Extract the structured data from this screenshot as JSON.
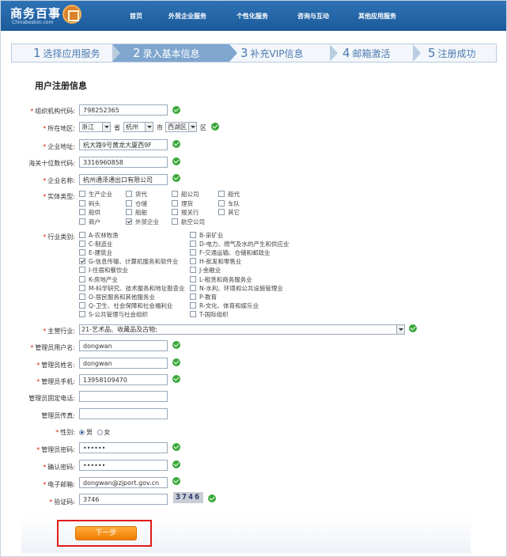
{
  "header": {
    "logo_text": "商务百事",
    "logo_sub": "Chinabeston.com",
    "nav": [
      "首页",
      "外贸企业服务",
      "个性化服务",
      "咨询与互动",
      "其他应用服务"
    ]
  },
  "steps": [
    {
      "num": "1",
      "label": "选择应用服务"
    },
    {
      "num": "2",
      "label": "录入基本信息"
    },
    {
      "num": "3",
      "label": "补充VIP信息"
    },
    {
      "num": "4",
      "label": "邮箱激活"
    },
    {
      "num": "5",
      "label": "注册成功"
    }
  ],
  "form": {
    "section_title": "用户注册信息",
    "org_code": {
      "label": "组织机构代码:",
      "value": "798252365"
    },
    "region": {
      "label": "所在地区:",
      "province": "浙江",
      "province_unit": "省",
      "city": "杭州",
      "city_unit": "市",
      "district": "西湖区",
      "district_unit": "区"
    },
    "address": {
      "label": "企业地址:",
      "value": "杭大路9号黄龙大厦西9F"
    },
    "customs_code": {
      "label": "海关十位数代码:",
      "value": "3316960858"
    },
    "company_name": {
      "label": "企业名称:",
      "value": "杭州通泽通出口有限公司"
    },
    "entity_type": {
      "label": "实体类型:",
      "options": [
        {
          "label": "生产企业",
          "checked": false
        },
        {
          "label": "货代",
          "checked": false
        },
        {
          "label": "船公司",
          "checked": false
        },
        {
          "label": "船代",
          "checked": false
        },
        {
          "label": "码头",
          "checked": false
        },
        {
          "label": "仓储",
          "checked": false
        },
        {
          "label": "理货",
          "checked": false
        },
        {
          "label": "车队",
          "checked": false
        },
        {
          "label": "船供",
          "checked": false
        },
        {
          "label": "船舶",
          "checked": false
        },
        {
          "label": "报关行",
          "checked": false
        },
        {
          "label": "其它",
          "checked": false
        },
        {
          "label": "商户",
          "checked": false
        },
        {
          "label": "外贸企业",
          "checked": true
        },
        {
          "label": "航空公司",
          "checked": false
        }
      ]
    },
    "industry": {
      "label": "行业类别:",
      "left": [
        {
          "label": "A-农林牧渔",
          "checked": false
        },
        {
          "label": "C-制造业",
          "checked": false
        },
        {
          "label": "E-建筑业",
          "checked": false
        },
        {
          "label": "G-信息传输、计算机服务和软件业",
          "checked": true
        },
        {
          "label": "I-住宿和餐饮业",
          "checked": false
        },
        {
          "label": "K-房地产业",
          "checked": false
        },
        {
          "label": "M-科学研究、技术服务和地址勘查业",
          "checked": false
        },
        {
          "label": "O-居民服务和其他服务业",
          "checked": false
        },
        {
          "label": "Q-卫生、社会保障和社会福利业",
          "checked": false
        },
        {
          "label": "S-公共管理与社会组织",
          "checked": false
        }
      ],
      "right": [
        {
          "label": "B-采矿业",
          "checked": false
        },
        {
          "label": "D-电力、燃气及水的产生和供应业",
          "checked": false
        },
        {
          "label": "F-交通运输、仓储和邮政业",
          "checked": false
        },
        {
          "label": "H-批发和零售业",
          "checked": false
        },
        {
          "label": "J-金融业",
          "checked": false
        },
        {
          "label": "L-租赁和商务服务业",
          "checked": false
        },
        {
          "label": "N-水利、环境和公共设施管理业",
          "checked": false
        },
        {
          "label": "P-教育",
          "checked": false
        },
        {
          "label": "R-文化、体育和娱乐业",
          "checked": false
        },
        {
          "label": "T-国际组织",
          "checked": false
        }
      ]
    },
    "main_industry": {
      "label": "主营行业:",
      "value": "21-艺术品、收藏品及古物;"
    },
    "admin_username": {
      "label": "管理员用户名:",
      "value": "dongwan"
    },
    "admin_name": {
      "label": "管理员姓名:",
      "value": "dongwan"
    },
    "admin_mobile": {
      "label": "管理员手机:",
      "value": "13958109470"
    },
    "admin_phone": {
      "label": "管理员固定电话:",
      "value": ""
    },
    "admin_fax": {
      "label": "管理员传真:",
      "value": ""
    },
    "gender": {
      "label": "性别:",
      "male": "男",
      "female": "女",
      "selected": "男"
    },
    "password": {
      "label": "管理员密码:",
      "value": "••••••"
    },
    "confirm_password": {
      "label": "确认密码:",
      "value": "••••••"
    },
    "email": {
      "label": "电子邮箱:",
      "value": "dongwan@zjport.gov.cn"
    },
    "captcha": {
      "label": "验证码:",
      "value": "3746",
      "image_text": "3746"
    },
    "next_button": "下一步"
  }
}
